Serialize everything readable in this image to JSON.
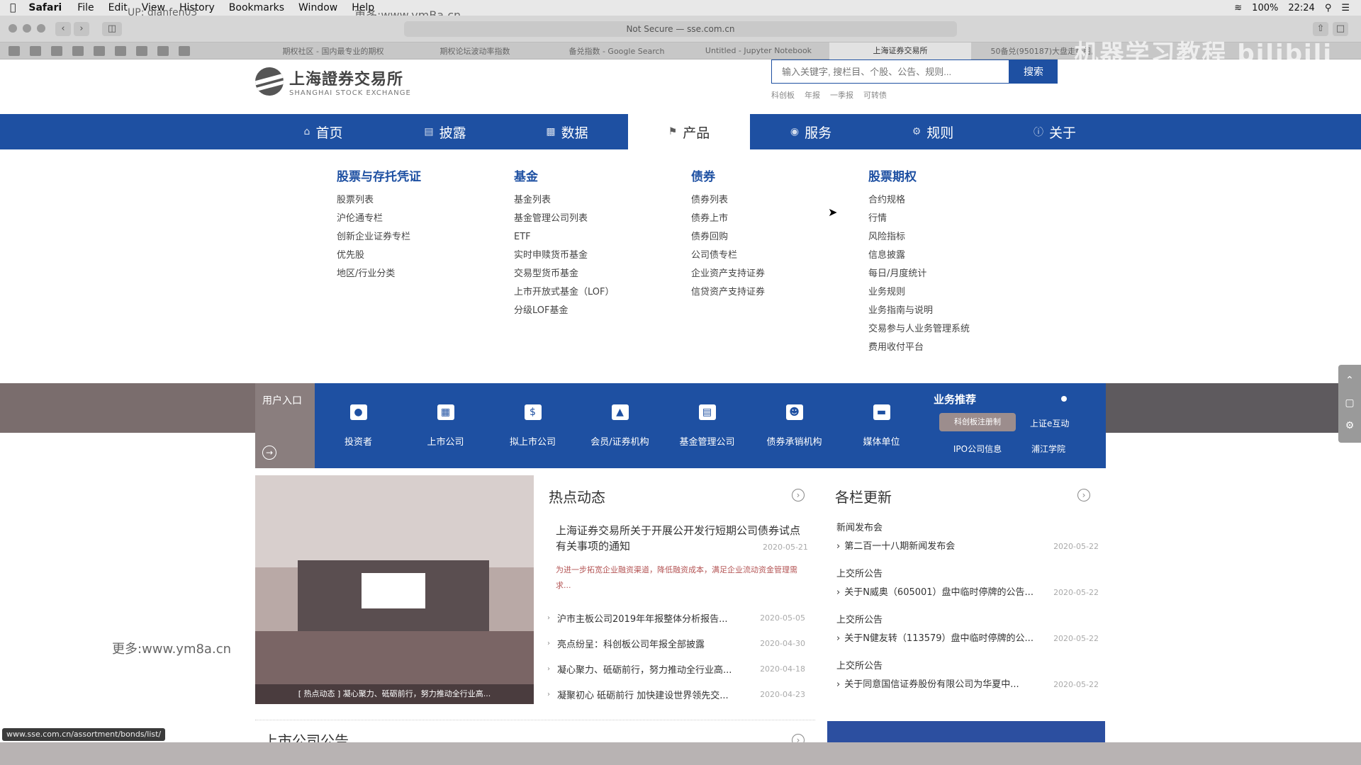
{
  "macbar": {
    "app": "Safari",
    "menus": [
      "File",
      "Edit",
      "View",
      "History",
      "Bookmarks",
      "Window",
      "Help"
    ],
    "battery": "100%",
    "time": "22:24"
  },
  "browser": {
    "address": "Not Secure — sse.com.cn",
    "tabs": [
      "期权社区 - 国内最专业的期权",
      "期权论坛波动率指数",
      "备兑指数 - Google Search",
      "Untitled - Jupyter Notebook",
      "上海证券交易所",
      "50备兑(950187)大盘走势图,"
    ],
    "status_url": "www.sse.com.cn/assortment/bonds/list/"
  },
  "watermarks": {
    "top": "更多:www.ymBa.cn",
    "left": "更多:www.ym8a.cn",
    "uploader": "UP: qianfen03",
    "bili_title": "机器学习教程",
    "bili_logo": "bilibili"
  },
  "site": {
    "logo_cn": "上海證券交易所",
    "logo_en": "SHANGHAI STOCK EXCHANGE",
    "search_placeholder": "输入关键字, 搜栏目、个股、公告、规则...",
    "search_button": "搜索",
    "hot_words": [
      "科创板",
      "年报",
      "一季报",
      "可转债"
    ]
  },
  "nav": [
    {
      "label": "首页",
      "icon": "home-icon"
    },
    {
      "label": "披露",
      "icon": "doc-icon"
    },
    {
      "label": "数据",
      "icon": "chart-icon"
    },
    {
      "label": "产品",
      "icon": "building-icon",
      "active": true
    },
    {
      "label": "服务",
      "icon": "service-icon"
    },
    {
      "label": "规则",
      "icon": "rules-icon"
    },
    {
      "label": "关于",
      "icon": "about-icon"
    }
  ],
  "dropdown": [
    {
      "title": "股票与存托凭证",
      "items": [
        "股票列表",
        "沪伦通专栏",
        "创新企业证券专栏",
        "优先股",
        "地区/行业分类"
      ]
    },
    {
      "title": "基金",
      "items": [
        "基金列表",
        "基金管理公司列表",
        "ETF",
        "实时申赎货币基金",
        "交易型货币基金",
        "上市开放式基金（LOF）",
        "分级LOF基金"
      ]
    },
    {
      "title": "债券",
      "items": [
        "债券列表",
        "债券上市",
        "债券回购",
        "公司债专栏",
        "企业资产支持证券",
        "信贷资产支持证券"
      ]
    },
    {
      "title": "股票期权",
      "items": [
        "合约规格",
        "行情",
        "风险指标",
        "信息披露",
        "每日/月度统计",
        "业务规则",
        "业务指南与说明",
        "交易参与人业务管理系统",
        "费用收付平台"
      ]
    }
  ],
  "userbar": {
    "entry": "用户入口",
    "items": [
      "投资者",
      "上市公司",
      "拟上市公司",
      "会员/证券机构",
      "基金管理公司",
      "债券承销机构",
      "媒体单位"
    ],
    "recommend_title": "业务推荐",
    "recommend": [
      "科创板注册制",
      "上证e互动",
      "IPO公司信息",
      "浦江学院"
    ]
  },
  "hot": {
    "title": "热点动态",
    "featured_title": "上海证券交易所关于开展公开发行短期公司债券试点有关事项的通知",
    "featured_date": "2020-05-21",
    "featured_summary": "为进一步拓宽企业融资渠道，降低融资成本，满足企业流动资金管理需求...",
    "list": [
      {
        "text": "沪市主板公司2019年年报整体分析报告...",
        "date": "2020-05-05"
      },
      {
        "text": "亮点纷呈：科创板公司年报全部披露",
        "date": "2020-04-30"
      },
      {
        "text": "凝心聚力、砥砺前行，努力推动全行业高...",
        "date": "2020-04-18"
      },
      {
        "text": "凝聚初心 砥砺前行 加快建设世界领先交...",
        "date": "2020-04-23"
      }
    ],
    "photo_caption": "[ 热点动态 ] 凝心聚力、砥砺前行，努力推动全行业高..."
  },
  "updates": {
    "title": "各栏更新",
    "groups": [
      {
        "cat": "新闻发布会",
        "text": "第二百一十八期新闻发布会",
        "date": "2020-05-22"
      },
      {
        "cat": "上交所公告",
        "text": "关于N威奥（605001）盘中临时停牌的公告...",
        "date": "2020-05-22"
      },
      {
        "cat": "上交所公告",
        "text": "关于N健友转（113579）盘中临时停牌的公...",
        "date": "2020-05-22"
      },
      {
        "cat": "上交所公告",
        "text": "关于同意国信证券股份有限公司为华夏中...",
        "date": "2020-05-22"
      }
    ]
  },
  "bottom_title": "上市公司公告"
}
